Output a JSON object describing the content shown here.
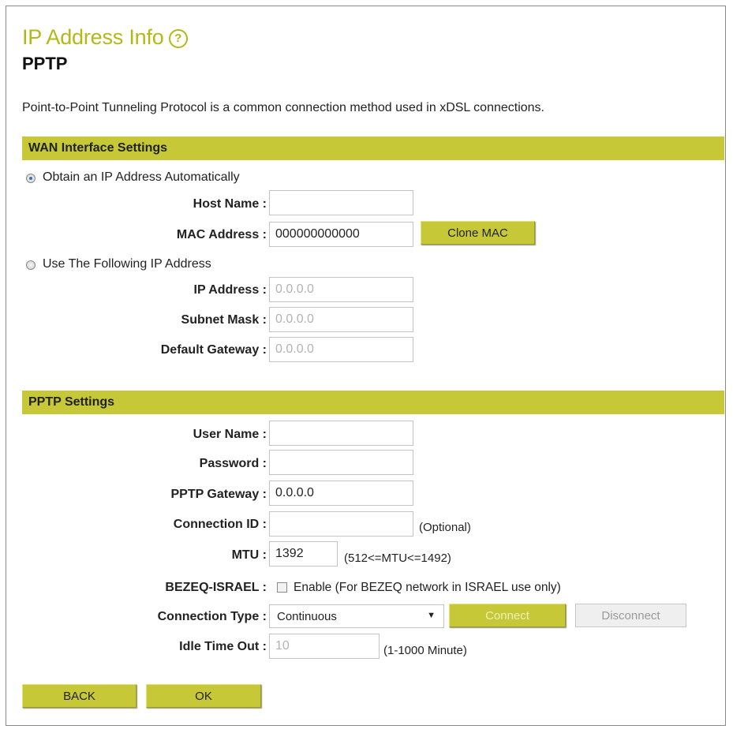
{
  "header": {
    "title": "IP Address Info",
    "help_icon": "help-circle-icon",
    "subtitle": "PPTP",
    "description": "Point-to-Point Tunneling Protocol is a common connection method used in xDSL connections."
  },
  "wan": {
    "section_title": "WAN Interface Settings",
    "auto_option": "Obtain an IP Address Automatically",
    "auto_selected": true,
    "host_name_label": "Host Name :",
    "host_name_value": "",
    "mac_label": "MAC Address :",
    "mac_value": "000000000000",
    "clone_mac_label": "Clone MAC",
    "static_option": "Use The Following IP Address",
    "ip_label": "IP Address :",
    "ip_value": "0.0.0.0",
    "subnet_label": "Subnet Mask :",
    "subnet_value": "0.0.0.0",
    "gateway_label": "Default Gateway :",
    "gateway_value": "0.0.0.0"
  },
  "pptp": {
    "section_title": "PPTP Settings",
    "user_label": "User Name :",
    "user_value": "",
    "password_label": "Password :",
    "password_value": "",
    "gateway_label": "PPTP Gateway :",
    "gateway_value": "0.0.0.0",
    "conn_id_label": "Connection ID :",
    "conn_id_value": "",
    "conn_id_hint": "(Optional)",
    "mtu_label": "MTU :",
    "mtu_value": "1392",
    "mtu_hint": "(512<=MTU<=1492)",
    "bezeq_label": "BEZEQ-ISRAEL :",
    "bezeq_checked": false,
    "bezeq_text": "Enable (For BEZEQ network in ISRAEL use only)",
    "conn_type_label": "Connection Type :",
    "conn_type_value": "Continuous",
    "connect_label": "Connect",
    "disconnect_label": "Disconnect",
    "idle_label": "Idle Time Out :",
    "idle_value": "10",
    "idle_hint": "(1-1000 Minute)"
  },
  "footer": {
    "back_label": "BACK",
    "ok_label": "OK"
  },
  "colors": {
    "accent": "#c6c837",
    "title": "#b4b816",
    "radio_selected": "#3d6fb0"
  }
}
